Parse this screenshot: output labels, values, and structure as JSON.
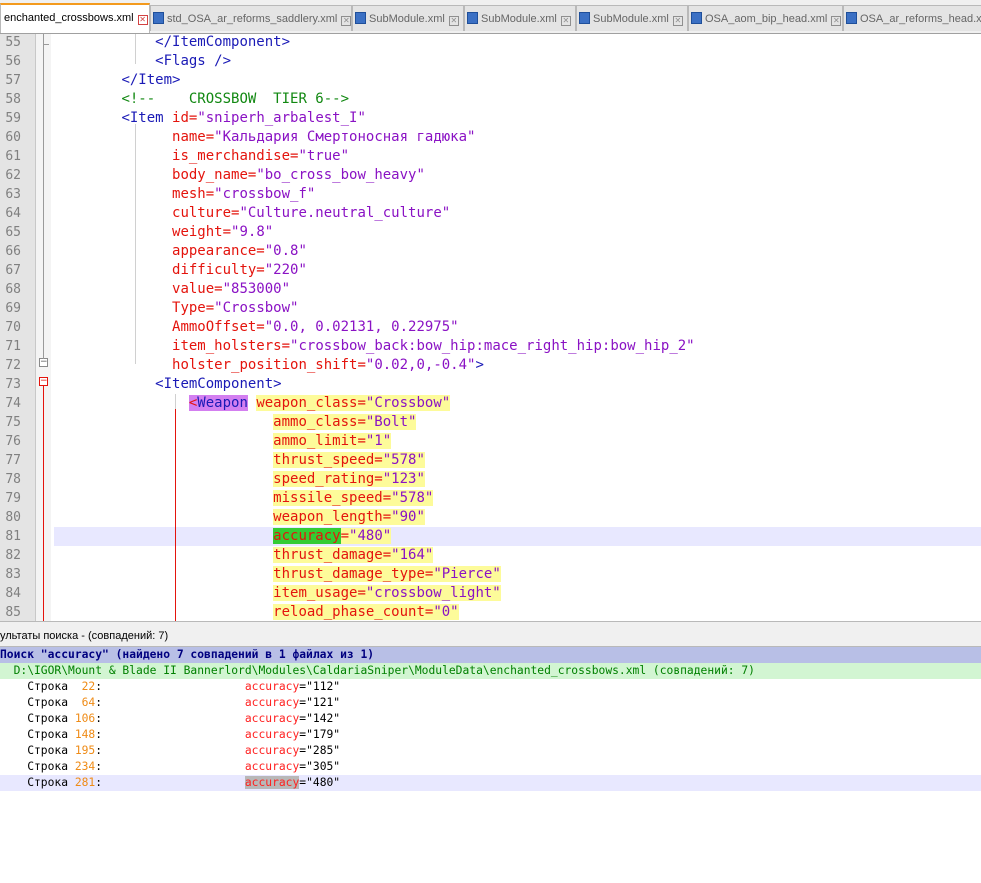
{
  "tabs": [
    {
      "label": "enchanted_crossbows.xml",
      "active": true
    },
    {
      "label": "std_OSA_ar_reforms_saddlery.xml",
      "active": false
    },
    {
      "label": "SubModule.xml",
      "active": false
    },
    {
      "label": "SubModule.xml",
      "active": false
    },
    {
      "label": "SubModule.xml",
      "active": false
    },
    {
      "label": "OSA_aom_bip_head.xml",
      "active": false
    },
    {
      "label": "OSA_ar_reforms_head.xm",
      "active": false
    }
  ],
  "editor": {
    "current_line": 81,
    "lines": [
      {
        "n": "55",
        "segs": [
          [
            "            ",
            "t"
          ],
          [
            "</ItemComponent>",
            "tg"
          ]
        ]
      },
      {
        "n": "56",
        "segs": [
          [
            "            ",
            "t"
          ],
          [
            "<Flags />",
            "tg"
          ]
        ]
      },
      {
        "n": "57",
        "segs": [
          [
            "        ",
            "t"
          ],
          [
            "</Item>",
            "tg"
          ]
        ]
      },
      {
        "n": "58",
        "segs": [
          [
            "        ",
            "t"
          ],
          [
            "<!--    CROSSBOW  TIER 6-->",
            "cm"
          ]
        ]
      },
      {
        "n": "59",
        "segs": [
          [
            "        ",
            "t"
          ],
          [
            "<Item ",
            "tg"
          ],
          [
            "id=",
            "an"
          ],
          [
            "\"sniperh_arbalest_I\"",
            "av"
          ]
        ]
      },
      {
        "n": "60",
        "segs": [
          [
            "              ",
            "t"
          ],
          [
            "name=",
            "an"
          ],
          [
            "\"Кальдария Смертоносная гадюка\"",
            "av"
          ]
        ]
      },
      {
        "n": "61",
        "segs": [
          [
            "              ",
            "t"
          ],
          [
            "is_merchandise=",
            "an"
          ],
          [
            "\"true\"",
            "av"
          ]
        ]
      },
      {
        "n": "62",
        "segs": [
          [
            "              ",
            "t"
          ],
          [
            "body_name=",
            "an"
          ],
          [
            "\"bo_cross_bow_heavy\"",
            "av"
          ]
        ]
      },
      {
        "n": "63",
        "segs": [
          [
            "              ",
            "t"
          ],
          [
            "mesh=",
            "an"
          ],
          [
            "\"crossbow_f\"",
            "av"
          ]
        ]
      },
      {
        "n": "64",
        "segs": [
          [
            "              ",
            "t"
          ],
          [
            "culture=",
            "an"
          ],
          [
            "\"Culture.neutral_culture\"",
            "av"
          ]
        ]
      },
      {
        "n": "65",
        "segs": [
          [
            "              ",
            "t"
          ],
          [
            "weight=",
            "an"
          ],
          [
            "\"9.8\"",
            "av"
          ]
        ]
      },
      {
        "n": "66",
        "segs": [
          [
            "              ",
            "t"
          ],
          [
            "appearance=",
            "an"
          ],
          [
            "\"0.8\"",
            "av"
          ]
        ]
      },
      {
        "n": "67",
        "segs": [
          [
            "              ",
            "t"
          ],
          [
            "difficulty=",
            "an"
          ],
          [
            "\"220\"",
            "av"
          ]
        ]
      },
      {
        "n": "68",
        "segs": [
          [
            "              ",
            "t"
          ],
          [
            "value=",
            "an"
          ],
          [
            "\"853000\"",
            "av"
          ]
        ]
      },
      {
        "n": "69",
        "segs": [
          [
            "              ",
            "t"
          ],
          [
            "Type=",
            "an"
          ],
          [
            "\"Crossbow\"",
            "av"
          ]
        ]
      },
      {
        "n": "70",
        "segs": [
          [
            "              ",
            "t"
          ],
          [
            "AmmoOffset=",
            "an"
          ],
          [
            "\"0.0, 0.02131, 0.22975\"",
            "av"
          ]
        ]
      },
      {
        "n": "71",
        "segs": [
          [
            "              ",
            "t"
          ],
          [
            "item_holsters=",
            "an"
          ],
          [
            "\"crossbow_back:bow_hip:mace_right_hip:bow_hip_2\"",
            "av"
          ]
        ]
      },
      {
        "n": "72",
        "segs": [
          [
            "              ",
            "t"
          ],
          [
            "holster_position_shift=",
            "an"
          ],
          [
            "\"0.02,0,-0.4\"",
            "av"
          ],
          [
            ">",
            "tg"
          ]
        ]
      },
      {
        "n": "73",
        "segs": [
          [
            "            ",
            "t"
          ],
          [
            "<ItemComponent>",
            "tg"
          ]
        ]
      },
      {
        "n": "74",
        "segs": [
          [
            "                ",
            "t"
          ],
          [
            "<",
            "ht"
          ],
          [
            "Weapon",
            "ht2"
          ],
          [
            " ",
            "t"
          ],
          [
            "weapon_class=",
            "an hy"
          ],
          [
            "\"Crossbow\"",
            "av hy"
          ]
        ]
      },
      {
        "n": "75",
        "segs": [
          [
            "                          ",
            "t"
          ],
          [
            "ammo_class=",
            "an hy"
          ],
          [
            "\"Bolt\"",
            "av hy"
          ]
        ]
      },
      {
        "n": "76",
        "segs": [
          [
            "                          ",
            "t"
          ],
          [
            "ammo_limit=",
            "an hy"
          ],
          [
            "\"1\"",
            "av hy"
          ]
        ]
      },
      {
        "n": "77",
        "segs": [
          [
            "                          ",
            "t"
          ],
          [
            "thrust_speed=",
            "an hy"
          ],
          [
            "\"578\"",
            "av hy"
          ]
        ]
      },
      {
        "n": "78",
        "segs": [
          [
            "                          ",
            "t"
          ],
          [
            "speed_rating=",
            "an hy"
          ],
          [
            "\"123\"",
            "av hy"
          ]
        ]
      },
      {
        "n": "79",
        "segs": [
          [
            "                          ",
            "t"
          ],
          [
            "missile_speed=",
            "an hy"
          ],
          [
            "\"578\"",
            "av hy"
          ]
        ]
      },
      {
        "n": "80",
        "segs": [
          [
            "                          ",
            "t"
          ],
          [
            "weapon_length=",
            "an hy"
          ],
          [
            "\"90\"",
            "av hy"
          ]
        ]
      },
      {
        "n": "81",
        "segs": [
          [
            "                          ",
            "t"
          ],
          [
            "accuracy",
            "an hg"
          ],
          [
            "=",
            "an hy"
          ],
          [
            "\"480\"",
            "av hy"
          ]
        ]
      },
      {
        "n": "82",
        "segs": [
          [
            "                          ",
            "t"
          ],
          [
            "thrust_damage=",
            "an hy"
          ],
          [
            "\"164\"",
            "av hy"
          ]
        ]
      },
      {
        "n": "83",
        "segs": [
          [
            "                          ",
            "t"
          ],
          [
            "thrust_damage_type=",
            "an hy"
          ],
          [
            "\"Pierce\"",
            "av hy"
          ]
        ]
      },
      {
        "n": "84",
        "segs": [
          [
            "                          ",
            "t"
          ],
          [
            "item_usage=",
            "an hy"
          ],
          [
            "\"crossbow_light\"",
            "av hy"
          ]
        ]
      },
      {
        "n": "85",
        "segs": [
          [
            "                          ",
            "t"
          ],
          [
            "reload_phase_count=",
            "an hy"
          ],
          [
            "\"0\"",
            "av hy"
          ]
        ]
      }
    ]
  },
  "search_panel": {
    "title": "ультаты поиска - (совпадений: 7)",
    "summary": "Поиск \"accuracy\" (найдено 7 совпадений в 1 файлах из 1)",
    "file": "  D:\\IGOR\\Mount & Blade II Bannerlord\\Modules\\CaldariaSniper\\ModuleData\\enchanted_crossbows.xml (совпадений: 7)",
    "row_prefix": "    Строка ",
    "results": [
      {
        "line": " 22",
        "pad": ":                     ",
        "key": "accuracy",
        "value": "=\"112\"",
        "current": false
      },
      {
        "line": " 64",
        "pad": ":                     ",
        "key": "accuracy",
        "value": "=\"121\"",
        "current": false
      },
      {
        "line": "106",
        "pad": ":                     ",
        "key": "accuracy",
        "value": "=\"142\"",
        "current": false
      },
      {
        "line": "148",
        "pad": ":                     ",
        "key": "accuracy",
        "value": "=\"179\"",
        "current": false
      },
      {
        "line": "195",
        "pad": ":                     ",
        "key": "accuracy",
        "value": "=\"285\"",
        "current": false
      },
      {
        "line": "234",
        "pad": ":                     ",
        "key": "accuracy",
        "value": "=\"305\"",
        "current": false
      },
      {
        "line": "281",
        "pad": ":                     ",
        "key": "accuracy",
        "value": "=\"480\"",
        "current": true
      }
    ]
  }
}
